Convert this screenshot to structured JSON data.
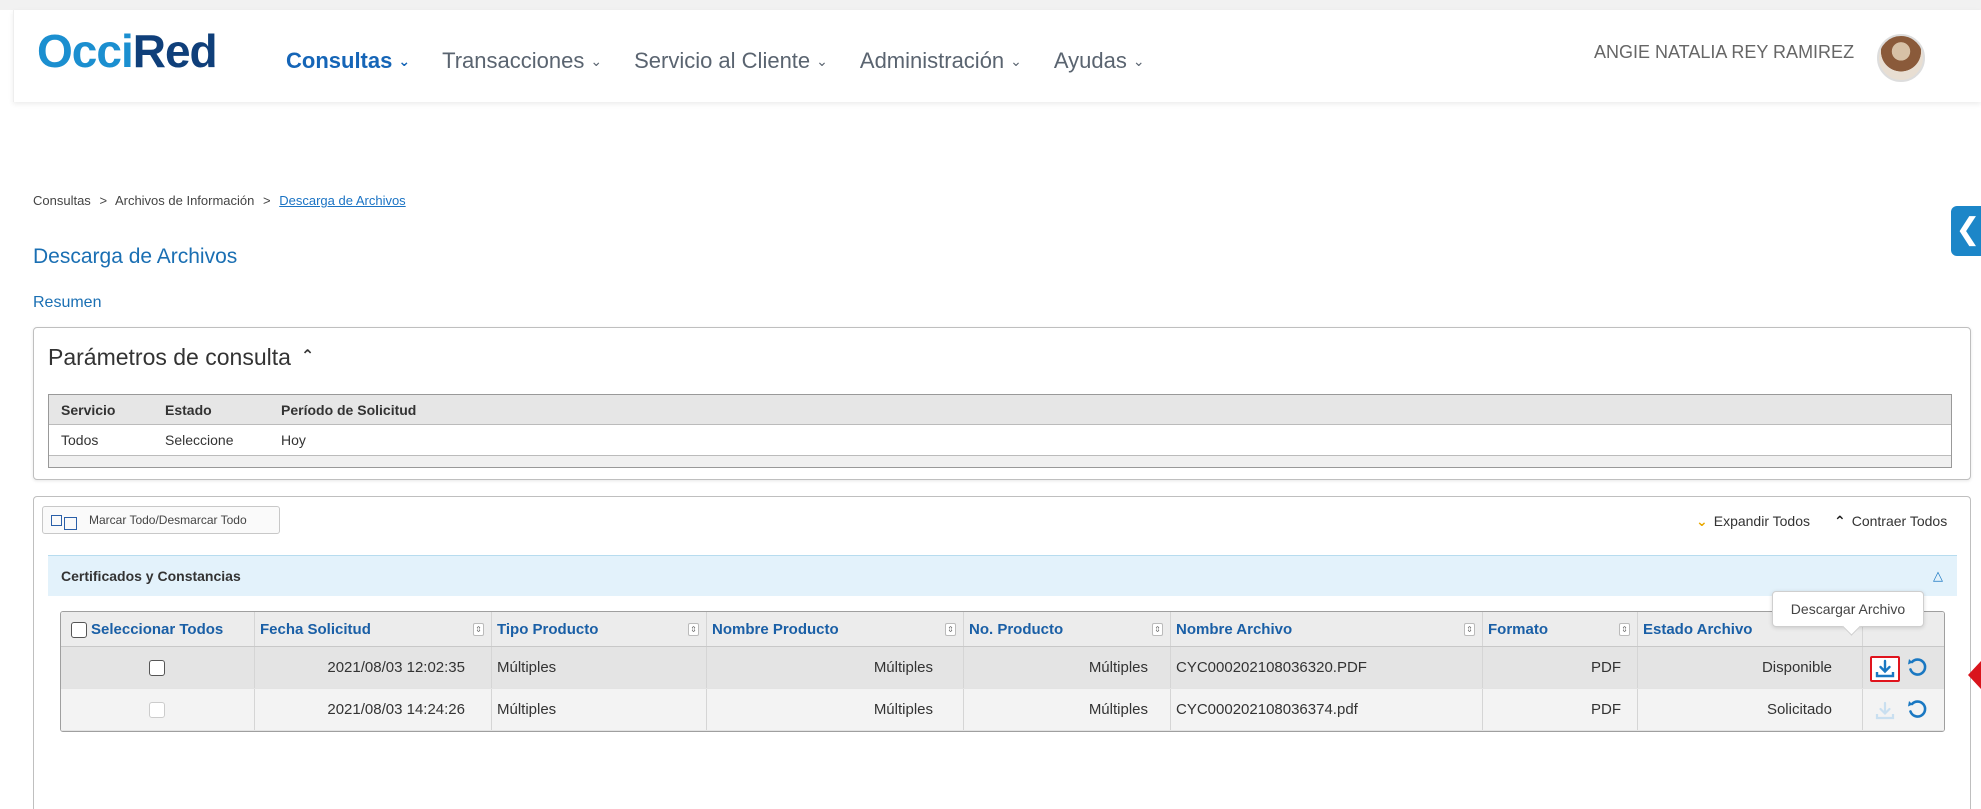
{
  "header": {
    "logo_part1": "Occi",
    "logo_part2": "Red",
    "nav": [
      {
        "label": "Consultas",
        "active": true
      },
      {
        "label": "Transacciones",
        "active": false
      },
      {
        "label": "Servicio al Cliente",
        "active": false
      },
      {
        "label": "Administración",
        "active": false
      },
      {
        "label": "Ayudas",
        "active": false
      }
    ],
    "user_name": "ANGIE NATALIA REY RAMIREZ"
  },
  "breadcrumb": {
    "item1": "Consultas",
    "sep": ">",
    "item2": "Archivos de Información",
    "current": "Descarga de Archivos"
  },
  "page_title": "Descarga de Archivos",
  "summary_link": "Resumen",
  "params": {
    "title": "Parámetros de consulta",
    "headers": [
      "Servicio",
      "Estado",
      "Período de Solicitud"
    ],
    "values": [
      "Todos",
      "Seleccione",
      "Hoy"
    ]
  },
  "results": {
    "mark_all_label": "Marcar Todo/Desmarcar Todo",
    "expand_label": "Expandir Todos",
    "contract_label": "Contraer Todos",
    "group_title": "Certificados y Constancias",
    "columns": {
      "select_all": "Seleccionar Todos",
      "fecha": "Fecha Solicitud",
      "tipo": "Tipo Producto",
      "nombre_producto": "Nombre Producto",
      "no_producto": "No. Producto",
      "nombre_archivo": "Nombre Archivo",
      "formato": "Formato",
      "estado": "Estado Archivo"
    },
    "rows": [
      {
        "fecha": "2021/08/03 12:02:35",
        "tipo": "Múltiples",
        "nombre_producto": "Múltiples",
        "no_producto": "Múltiples",
        "nombre_archivo": "CYC000202108036320.PDF",
        "formato": "PDF",
        "estado": "Disponible"
      },
      {
        "fecha": "2021/08/03 14:24:26",
        "tipo": "Múltiples",
        "nombre_producto": "Múltiples",
        "no_producto": "Múltiples",
        "nombre_archivo": "CYC000202108036374.pdf",
        "formato": "PDF",
        "estado": "Solicitado"
      }
    ],
    "tooltip": "Descargar Archivo"
  },
  "colors": {
    "brand_light": "#1b8fd0",
    "brand_dark": "#0f3f7a",
    "link": "#1a73c4",
    "highlight": "#e0141d"
  },
  "icons": {
    "sort": "sort-icon",
    "download": "download-icon",
    "refresh": "refresh-icon",
    "collapse": "collapse-icon"
  }
}
